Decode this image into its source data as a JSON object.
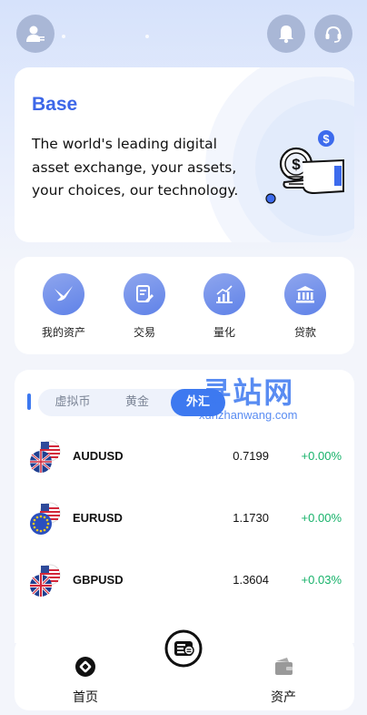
{
  "header": {
    "profile_icon": "user-icon",
    "notification_icon": "bell-icon",
    "support_icon": "headset-icon"
  },
  "hero": {
    "title": "Base",
    "text": "The world's leading digital asset exchange, your assets, your choices, our technology."
  },
  "menu": {
    "items": [
      {
        "label": "我的资产",
        "icon": "bird-icon"
      },
      {
        "label": "交易",
        "icon": "document-edit-icon"
      },
      {
        "label": "量化",
        "icon": "chart-icon"
      },
      {
        "label": "贷款",
        "icon": "bank-icon"
      }
    ]
  },
  "market": {
    "tabs": [
      "虚拟币",
      "黄金",
      "外汇"
    ],
    "active_tab": "外汇",
    "watermark": {
      "big": "寻站网",
      "small": "xunzhanwang.com"
    },
    "rows": [
      {
        "symbol": "AUDUSD",
        "price": "0.7199",
        "change": "+0.00%",
        "flag": "australia-flag-icon"
      },
      {
        "symbol": "EURUSD",
        "price": "1.1730",
        "change": "+0.00%",
        "flag": "eu-flag-icon"
      },
      {
        "symbol": "GBPUSD",
        "price": "1.3604",
        "change": "+0.03%",
        "flag": "uk-flag-icon"
      }
    ]
  },
  "nav": {
    "home": "首页",
    "assets": "资产",
    "center_icon": "exchange-icon"
  },
  "colors": {
    "accent": "#3d79f0",
    "brand_title": "#3d67e8",
    "positive": "#17b26a"
  }
}
